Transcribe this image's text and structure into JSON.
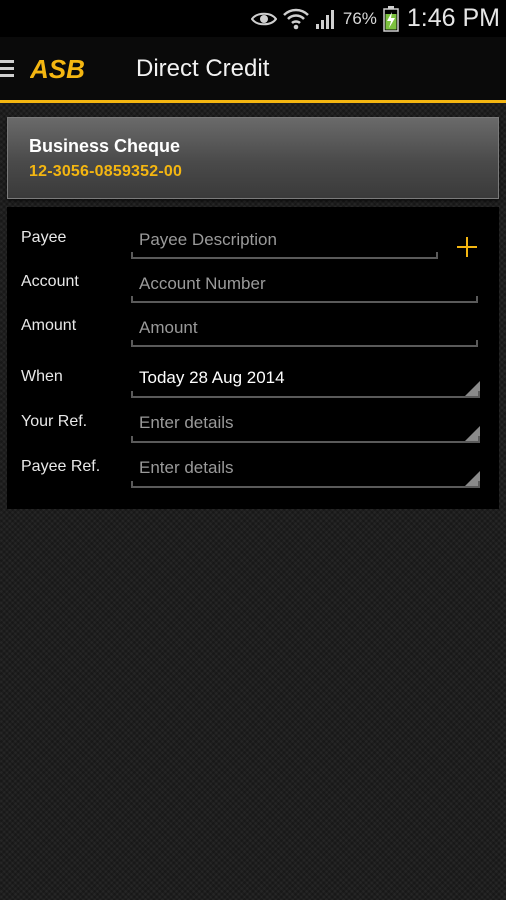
{
  "status_bar": {
    "battery_percent": "76%",
    "time": "1:46 PM",
    "icons": [
      "eye-icon",
      "wifi-icon",
      "signal-icon",
      "battery-charging-icon"
    ]
  },
  "app_bar": {
    "logo_text": "ASB",
    "title": "Direct Credit",
    "accent_color": "#f4b611"
  },
  "account": {
    "name": "Business Cheque",
    "number": "12-3056-0859352-00"
  },
  "form": {
    "payee": {
      "label": "Payee",
      "placeholder": "Payee Description",
      "add_icon": "plus-icon"
    },
    "account": {
      "label": "Account",
      "placeholder": "Account Number"
    },
    "amount": {
      "label": "Amount",
      "placeholder": "Amount"
    },
    "when": {
      "label": "When",
      "value": "Today 28 Aug 2014"
    },
    "your_ref": {
      "label": "Your Ref.",
      "placeholder": "Enter details"
    },
    "payee_ref": {
      "label": "Payee Ref.",
      "placeholder": "Enter details"
    }
  }
}
